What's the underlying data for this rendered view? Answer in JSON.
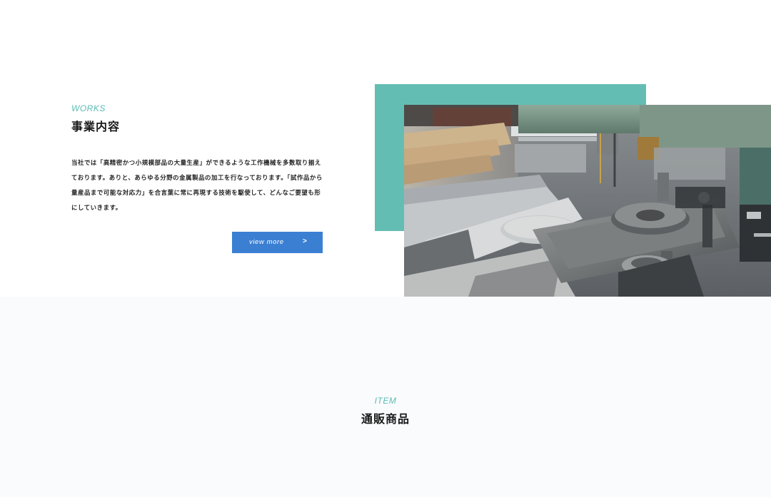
{
  "works": {
    "eyebrow": "WORKS",
    "title": "事業内容",
    "body": "当社では「高精密かつ小規模部品の大量生産」ができるような工作機械を多数取り揃えております。ありと、あらゆる分野の金属製品の加工を行なっております。「試作品から量産品まで可能な対応力」を合言葉に常に再現する技術を駆使して、どんなご要望も形にしていきます。",
    "button_label": "view more",
    "button_arrow": ">"
  },
  "item": {
    "eyebrow": "ITEM",
    "title": "通販商品"
  },
  "colors": {
    "accent_teal": "#64bdb3",
    "eyebrow_teal": "#5bbcb3",
    "button_blue": "#3b7fd2",
    "lower_bg": "#fafbfd"
  },
  "icons": {
    "button_arrow": "chevron-right-icon"
  }
}
